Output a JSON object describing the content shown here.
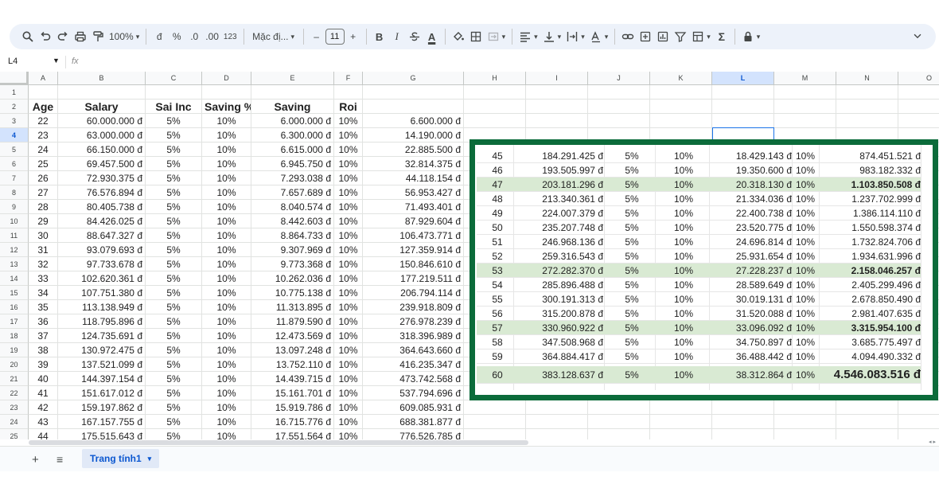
{
  "toolbar": {
    "zoom": "100%",
    "currency": "đ",
    "percent": "%",
    "dec_decrease": ".0",
    "dec_increase": ".00",
    "number_format": "123",
    "font_family": "Mặc đị...",
    "font_size": "11",
    "minus": "–",
    "plus": "+",
    "bold": "B",
    "italic": "I",
    "text_color": "A"
  },
  "namebox": {
    "ref": "L4",
    "fx": "fx"
  },
  "columns": [
    "A",
    "B",
    "C",
    "D",
    "E",
    "F",
    "G",
    "H",
    "I",
    "J",
    "K",
    "L",
    "M",
    "N",
    "O"
  ],
  "selected_column": "L",
  "selected_row": "4",
  "row_numbers": [
    "1",
    "2",
    "3",
    "4",
    "5",
    "6",
    "7",
    "8",
    "9",
    "10",
    "11",
    "12",
    "13",
    "14",
    "15",
    "16",
    "17",
    "18",
    "19",
    "20",
    "21",
    "22",
    "23",
    "24",
    "25"
  ],
  "headers": {
    "age": "Age",
    "salary": "Salary",
    "sai_inc": "Sai Inc",
    "saving_pct": "Saving %",
    "saving": "Saving",
    "roi": "Roi"
  },
  "rows": [
    [
      "22",
      "60.000.000 đ",
      "5%",
      "10%",
      "6.000.000 đ",
      "10%",
      "6.600.000 đ"
    ],
    [
      "23",
      "63.000.000 đ",
      "5%",
      "10%",
      "6.300.000 đ",
      "10%",
      "14.190.000 đ"
    ],
    [
      "24",
      "66.150.000 đ",
      "5%",
      "10%",
      "6.615.000 đ",
      "10%",
      "22.885.500 đ"
    ],
    [
      "25",
      "69.457.500 đ",
      "5%",
      "10%",
      "6.945.750 đ",
      "10%",
      "32.814.375 đ"
    ],
    [
      "26",
      "72.930.375 đ",
      "5%",
      "10%",
      "7.293.038 đ",
      "10%",
      "44.118.154 đ"
    ],
    [
      "27",
      "76.576.894 đ",
      "5%",
      "10%",
      "7.657.689 đ",
      "10%",
      "56.953.427 đ"
    ],
    [
      "28",
      "80.405.738 đ",
      "5%",
      "10%",
      "8.040.574 đ",
      "10%",
      "71.493.401 đ"
    ],
    [
      "29",
      "84.426.025 đ",
      "5%",
      "10%",
      "8.442.603 đ",
      "10%",
      "87.929.604 đ"
    ],
    [
      "30",
      "88.647.327 đ",
      "5%",
      "10%",
      "8.864.733 đ",
      "10%",
      "106.473.771 đ"
    ],
    [
      "31",
      "93.079.693 đ",
      "5%",
      "10%",
      "9.307.969 đ",
      "10%",
      "127.359.914 đ"
    ],
    [
      "32",
      "97.733.678 đ",
      "5%",
      "10%",
      "9.773.368 đ",
      "10%",
      "150.846.610 đ"
    ],
    [
      "33",
      "102.620.361 đ",
      "5%",
      "10%",
      "10.262.036 đ",
      "10%",
      "177.219.511 đ"
    ],
    [
      "34",
      "107.751.380 đ",
      "5%",
      "10%",
      "10.775.138 đ",
      "10%",
      "206.794.114 đ"
    ],
    [
      "35",
      "113.138.949 đ",
      "5%",
      "10%",
      "11.313.895 đ",
      "10%",
      "239.918.809 đ"
    ],
    [
      "36",
      "118.795.896 đ",
      "5%",
      "10%",
      "11.879.590 đ",
      "10%",
      "276.978.239 đ"
    ],
    [
      "37",
      "124.735.691 đ",
      "5%",
      "10%",
      "12.473.569 đ",
      "10%",
      "318.396.989 đ"
    ],
    [
      "38",
      "130.972.475 đ",
      "5%",
      "10%",
      "13.097.248 đ",
      "10%",
      "364.643.660 đ"
    ],
    [
      "39",
      "137.521.099 đ",
      "5%",
      "10%",
      "13.752.110 đ",
      "10%",
      "416.235.347 đ"
    ],
    [
      "40",
      "144.397.154 đ",
      "5%",
      "10%",
      "14.439.715 đ",
      "10%",
      "473.742.568 đ"
    ],
    [
      "41",
      "151.617.012 đ",
      "5%",
      "10%",
      "15.161.701 đ",
      "10%",
      "537.794.696 đ"
    ],
    [
      "42",
      "159.197.862 đ",
      "5%",
      "10%",
      "15.919.786 đ",
      "10%",
      "609.085.931 đ"
    ],
    [
      "43",
      "167.157.755 đ",
      "5%",
      "10%",
      "16.715.776 đ",
      "10%",
      "688.381.877 đ"
    ],
    [
      "44",
      "175.515.643 đ",
      "5%",
      "10%",
      "17.551.564 đ",
      "10%",
      "776.526.785 đ"
    ]
  ],
  "overlay_rows": [
    {
      "age": "45",
      "salary": "184.291.425 đ",
      "inc": "5%",
      "sp": "10%",
      "saving": "18.429.143 đ",
      "roi": "10%",
      "total": "874.451.521 đ",
      "hl": false,
      "bold": false
    },
    {
      "age": "46",
      "salary": "193.505.997 đ",
      "inc": "5%",
      "sp": "10%",
      "saving": "19.350.600 đ",
      "roi": "10%",
      "total": "983.182.332 đ",
      "hl": false,
      "bold": false
    },
    {
      "age": "47",
      "salary": "203.181.296 đ",
      "inc": "5%",
      "sp": "10%",
      "saving": "20.318.130 đ",
      "roi": "10%",
      "total": "1.103.850.508 đ",
      "hl": true,
      "bold": true
    },
    {
      "age": "48",
      "salary": "213.340.361 đ",
      "inc": "5%",
      "sp": "10%",
      "saving": "21.334.036 đ",
      "roi": "10%",
      "total": "1.237.702.999 đ",
      "hl": false,
      "bold": false
    },
    {
      "age": "49",
      "salary": "224.007.379 đ",
      "inc": "5%",
      "sp": "10%",
      "saving": "22.400.738 đ",
      "roi": "10%",
      "total": "1.386.114.110 đ",
      "hl": false,
      "bold": false
    },
    {
      "age": "50",
      "salary": "235.207.748 đ",
      "inc": "5%",
      "sp": "10%",
      "saving": "23.520.775 đ",
      "roi": "10%",
      "total": "1.550.598.374 đ",
      "hl": false,
      "bold": false
    },
    {
      "age": "51",
      "salary": "246.968.136 đ",
      "inc": "5%",
      "sp": "10%",
      "saving": "24.696.814 đ",
      "roi": "10%",
      "total": "1.732.824.706 đ",
      "hl": false,
      "bold": false
    },
    {
      "age": "52",
      "salary": "259.316.543 đ",
      "inc": "5%",
      "sp": "10%",
      "saving": "25.931.654 đ",
      "roi": "10%",
      "total": "1.934.631.996 đ",
      "hl": false,
      "bold": false
    },
    {
      "age": "53",
      "salary": "272.282.370 đ",
      "inc": "5%",
      "sp": "10%",
      "saving": "27.228.237 đ",
      "roi": "10%",
      "total": "2.158.046.257 đ",
      "hl": true,
      "bold": true
    },
    {
      "age": "54",
      "salary": "285.896.488 đ",
      "inc": "5%",
      "sp": "10%",
      "saving": "28.589.649 đ",
      "roi": "10%",
      "total": "2.405.299.496 đ",
      "hl": false,
      "bold": false
    },
    {
      "age": "55",
      "salary": "300.191.313 đ",
      "inc": "5%",
      "sp": "10%",
      "saving": "30.019.131 đ",
      "roi": "10%",
      "total": "2.678.850.490 đ",
      "hl": false,
      "bold": false
    },
    {
      "age": "56",
      "salary": "315.200.878 đ",
      "inc": "5%",
      "sp": "10%",
      "saving": "31.520.088 đ",
      "roi": "10%",
      "total": "2.981.407.635 đ",
      "hl": false,
      "bold": false
    },
    {
      "age": "57",
      "salary": "330.960.922 đ",
      "inc": "5%",
      "sp": "10%",
      "saving": "33.096.092 đ",
      "roi": "10%",
      "total": "3.315.954.100 đ",
      "hl": true,
      "bold": true
    },
    {
      "age": "58",
      "salary": "347.508.968 đ",
      "inc": "5%",
      "sp": "10%",
      "saving": "34.750.897 đ",
      "roi": "10%",
      "total": "3.685.775.497 đ",
      "hl": false,
      "bold": false
    },
    {
      "age": "59",
      "salary": "364.884.417 đ",
      "inc": "5%",
      "sp": "10%",
      "saving": "36.488.442 đ",
      "roi": "10%",
      "total": "4.094.490.332 đ",
      "hl": false,
      "bold": false
    },
    {
      "age": "60",
      "salary": "383.128.637 đ",
      "inc": "5%",
      "sp": "10%",
      "saving": "38.312.864 đ",
      "roi": "10%",
      "total": "4.546.083.516 đ",
      "hl": true,
      "bold": true,
      "xl": true
    }
  ],
  "sheet": {
    "add": "+",
    "all": "≡",
    "tab_name": "Trang tính1"
  },
  "colors": {
    "highlight": "#d9ead3",
    "frame": "#0b6b3a",
    "accent": "#0b57d0"
  }
}
